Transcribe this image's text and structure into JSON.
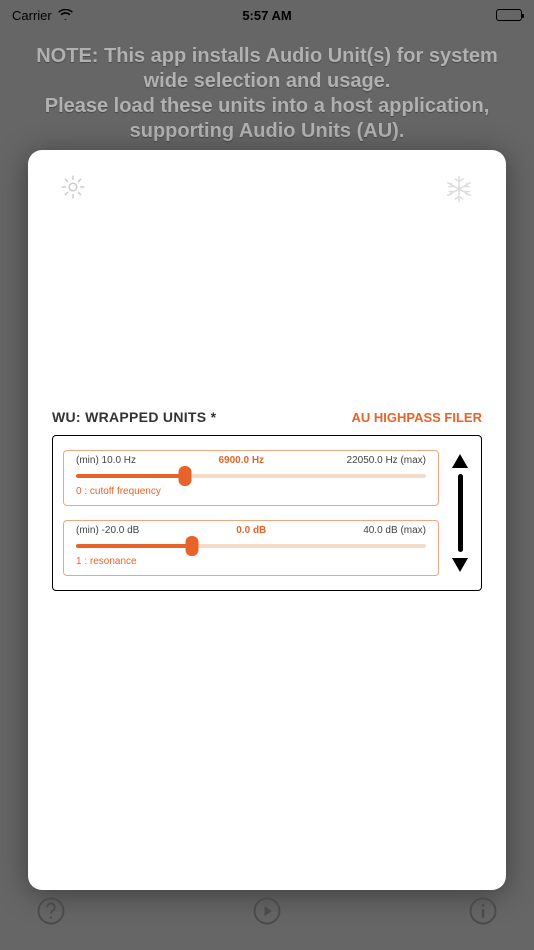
{
  "status_bar": {
    "carrier": "Carrier",
    "time": "5:57 AM"
  },
  "note_line1": "NOTE: This app installs Audio Unit(s) for system",
  "note_line2": "wide selection and usage.",
  "note_line3": "Please load these units into a host application,",
  "note_line4": "supporting Audio Units (AU).",
  "modal": {
    "title_left": "WU: WRAPPED UNITS *",
    "title_right": "AU HIGHPASS FILER",
    "params": [
      {
        "min_label": "(min) 10.0 Hz",
        "value_label": "6900.0 Hz",
        "max_label": "22050.0 Hz (max)",
        "name": "0 : cutoff frequency",
        "fill_percent": 31
      },
      {
        "min_label": "(min) -20.0 dB",
        "value_label": "0.0 dB",
        "max_label": "40.0 dB (max)",
        "name": "1 : resonance",
        "fill_percent": 33
      }
    ]
  }
}
